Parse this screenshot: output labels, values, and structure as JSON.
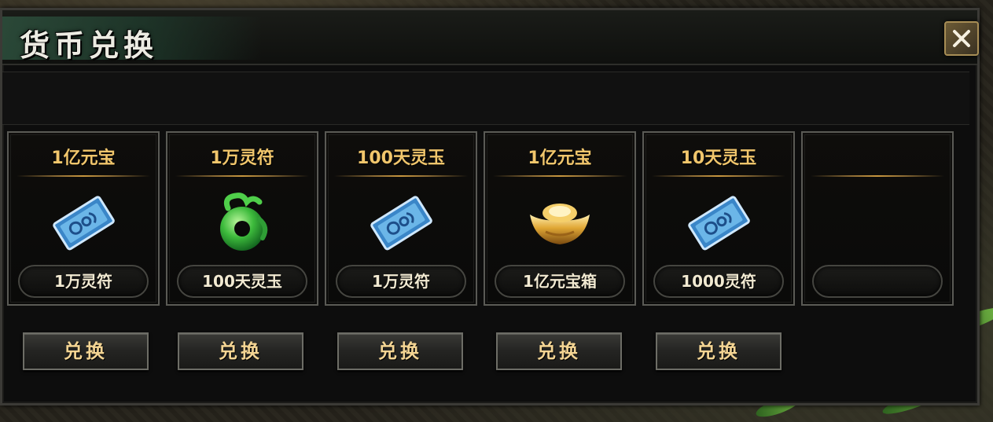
{
  "window": {
    "title": "货币兑换"
  },
  "cards": [
    {
      "cost": "1亿元宝",
      "reward": "1万灵符",
      "icon": "ticket-icon"
    },
    {
      "cost": "1万灵符",
      "reward": "100天灵玉",
      "icon": "jade-dragon-icon"
    },
    {
      "cost": "100天灵玉",
      "reward": "1万灵符",
      "icon": "ticket-icon"
    },
    {
      "cost": "1亿元宝",
      "reward": "1亿元宝箱",
      "icon": "gold-ingot-icon"
    },
    {
      "cost": "10天灵玉",
      "reward": "1000灵符",
      "icon": "ticket-icon"
    },
    {
      "cost": "",
      "reward": "",
      "icon": ""
    }
  ],
  "buttons": {
    "exchange_label": "兑换"
  },
  "colors": {
    "cost_text": "#f1c66c",
    "button_text": "#f3d493",
    "panel_bg": "#0d0d0d"
  }
}
